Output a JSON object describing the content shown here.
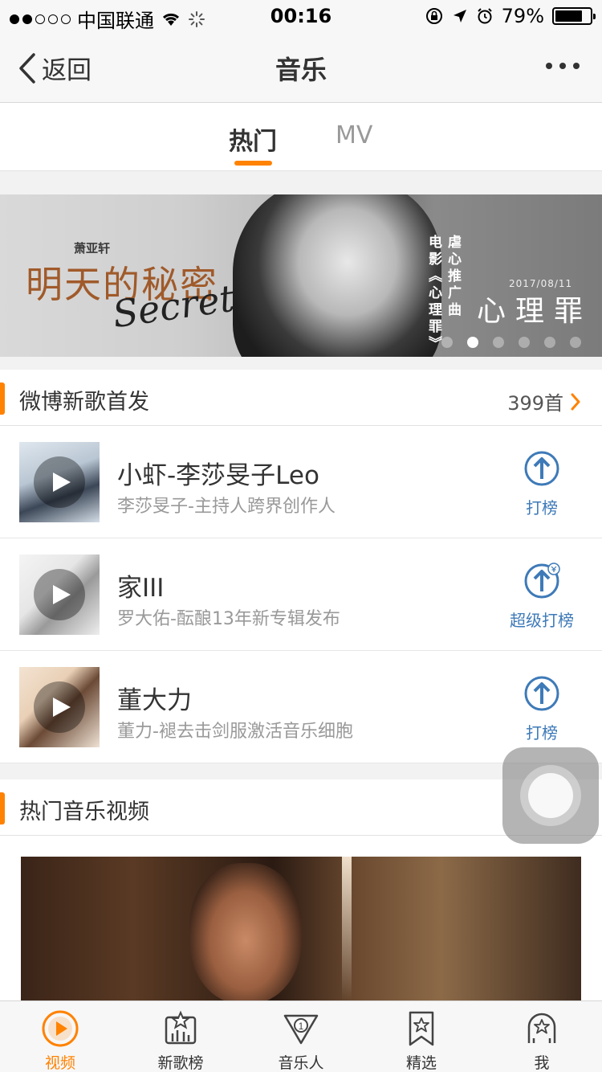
{
  "status_bar": {
    "carrier": "中国联通",
    "time": "00:16",
    "battery": "79%",
    "battery_level": 0.79
  },
  "nav": {
    "back_label": "返回",
    "title": "音乐"
  },
  "tabs": {
    "hot": "热门",
    "mv": "MV",
    "active": "hot"
  },
  "banner": {
    "artist": "萧亚轩",
    "title": "明天的秘密",
    "script_text": "Secret",
    "vertical_line_1": "虐心推广曲",
    "vertical_line_2": "电影《心理罪》",
    "date": "2017/08/11",
    "movie_title": "心理罪",
    "slide_count": 6,
    "active_slide": 1
  },
  "new_songs_section": {
    "title": "微博新歌首发",
    "count_label": "399首"
  },
  "songs": [
    {
      "title": "小虾-李莎旻子Leo",
      "subtitle": "李莎旻子-主持人跨界创作人",
      "action": "打榜",
      "premium": false
    },
    {
      "title": "家III",
      "subtitle": "罗大佑-酝酿13年新专辑发布",
      "action": "超级打榜",
      "premium": true
    },
    {
      "title": "董大力",
      "subtitle": "董力-褪去击剑服激活音乐细胞",
      "action": "打榜",
      "premium": false
    }
  ],
  "video_section": {
    "title": "热门音乐视频"
  },
  "tabbar": {
    "items": [
      {
        "label": "视频",
        "icon": "video-play-icon",
        "active": true
      },
      {
        "label": "新歌榜",
        "icon": "new-songs-chart-icon",
        "active": false
      },
      {
        "label": "音乐人",
        "icon": "musician-rank-icon",
        "active": false
      },
      {
        "label": "精选",
        "icon": "bookmark-star-icon",
        "active": false
      },
      {
        "label": "我",
        "icon": "profile-icon",
        "active": false
      }
    ]
  },
  "colors": {
    "accent": "#ff8200",
    "vote_blue": "#3e7ab8",
    "text_primary": "#333333",
    "text_secondary": "#999999"
  }
}
